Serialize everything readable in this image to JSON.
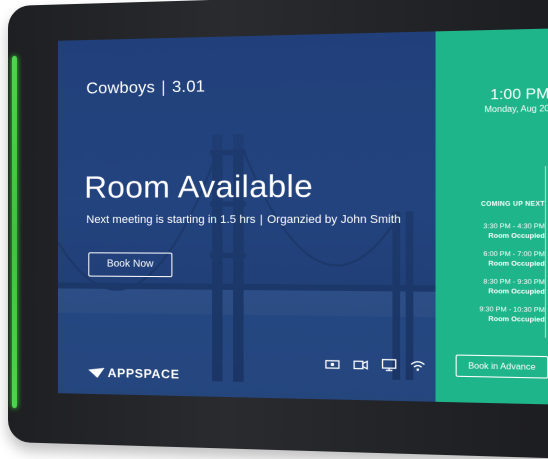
{
  "room": {
    "name": "Cowboys",
    "separator": "|",
    "number": "3.01"
  },
  "status": {
    "title": "Room Available",
    "next_meeting": "Next meeting is starting in 1.5 hrs",
    "separator": "|",
    "organizer": "Organzied by John Smith"
  },
  "actions": {
    "book_now": "Book Now",
    "book_in_advance": "Book in Advance"
  },
  "brand": {
    "name": "APPSPACE"
  },
  "clock": {
    "time": "1:00 PM",
    "date": "Monday, Aug 20"
  },
  "schedule": {
    "heading": "COMING UP NEXT",
    "items": [
      {
        "time": "3:30 PM - 4:30 PM",
        "status": "Room Occupied"
      },
      {
        "time": "6:00 PM - 7:00 PM",
        "status": "Room Occupied"
      },
      {
        "time": "8:30 PM - 9:30 PM",
        "status": "Room Occupied"
      },
      {
        "time": "9:30 PM - 10:30 PM",
        "status": "Room Occupied"
      }
    ]
  },
  "icons": [
    "projector-icon",
    "video-camera-icon",
    "display-icon",
    "wifi-icon"
  ],
  "colors": {
    "side_panel": "#1fb58a",
    "main_overlay": "#23407a",
    "led": "#4cd64c",
    "bezel": "#1e1f22"
  }
}
